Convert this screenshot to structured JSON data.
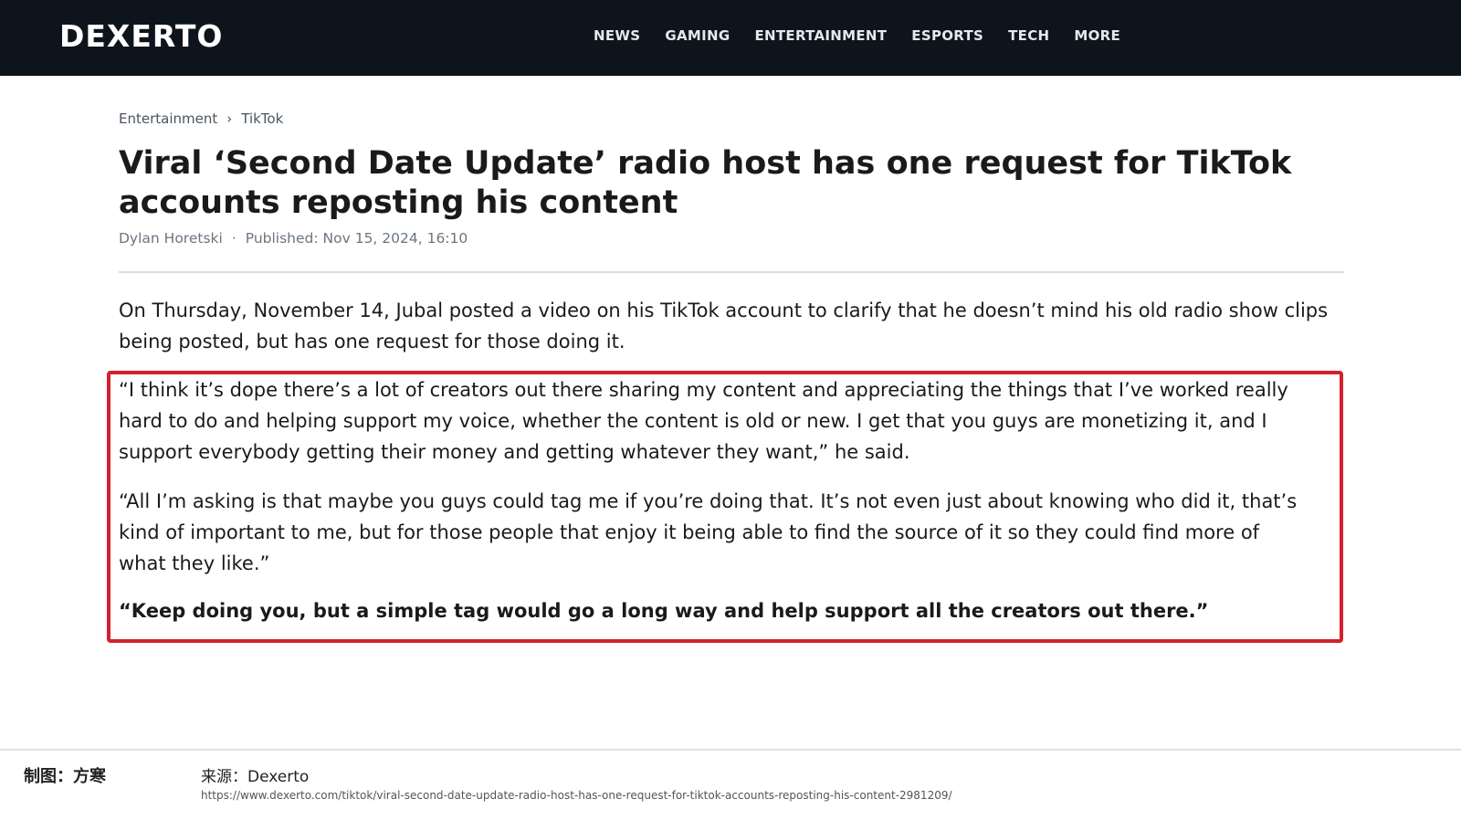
{
  "site": {
    "logo": "DEXERTO"
  },
  "nav": {
    "items": [
      "NEWS",
      "GAMING",
      "ENTERTAINMENT",
      "ESPORTS",
      "TECH",
      "MORE"
    ]
  },
  "breadcrumb": {
    "items": [
      "Entertainment",
      "TikTok"
    ],
    "separator": "›"
  },
  "article": {
    "title": "Viral ‘Second Date Update’ radio host has one request for TikTok accounts reposting his content",
    "author": "Dylan Horetski",
    "meta_separator": "·",
    "published": "Published: Nov 15, 2024, 16:10",
    "lead": "On Thursday, November 14, Jubal posted a video on his TikTok account to clarify that he doesn’t mind his old radio show clips being posted, but has one request for those doing it.",
    "quotes": [
      "“I think it’s dope there’s a lot of creators out there sharing my content and appreciating the things that I’ve worked really hard to do and helping support my voice, whether the content is old or new. I get that you guys are monetizing it, and I support everybody getting their money and getting whatever they want,” he said.",
      "“All I’m asking is that maybe you guys could tag me if you’re doing that. It’s not even just about knowing who did it, that’s kind of important to me, but for those people that enjoy it being able to find the source of it so they could find more of what they like.”"
    ],
    "highlight_quote": "“Keep doing you, but a simple tag would go a long way and help support all the creators out there.”"
  },
  "footer": {
    "credit": "制图：方寒",
    "source": "来源：Dexerto",
    "url": "https://www.dexerto.com/tiktok/viral-second-date-update-radio-host-has-one-request-for-tiktok-accounts-reposting-his-content-2981209/"
  },
  "colors": {
    "topbar": "#0e141c",
    "highlight_border": "#d4202e"
  }
}
